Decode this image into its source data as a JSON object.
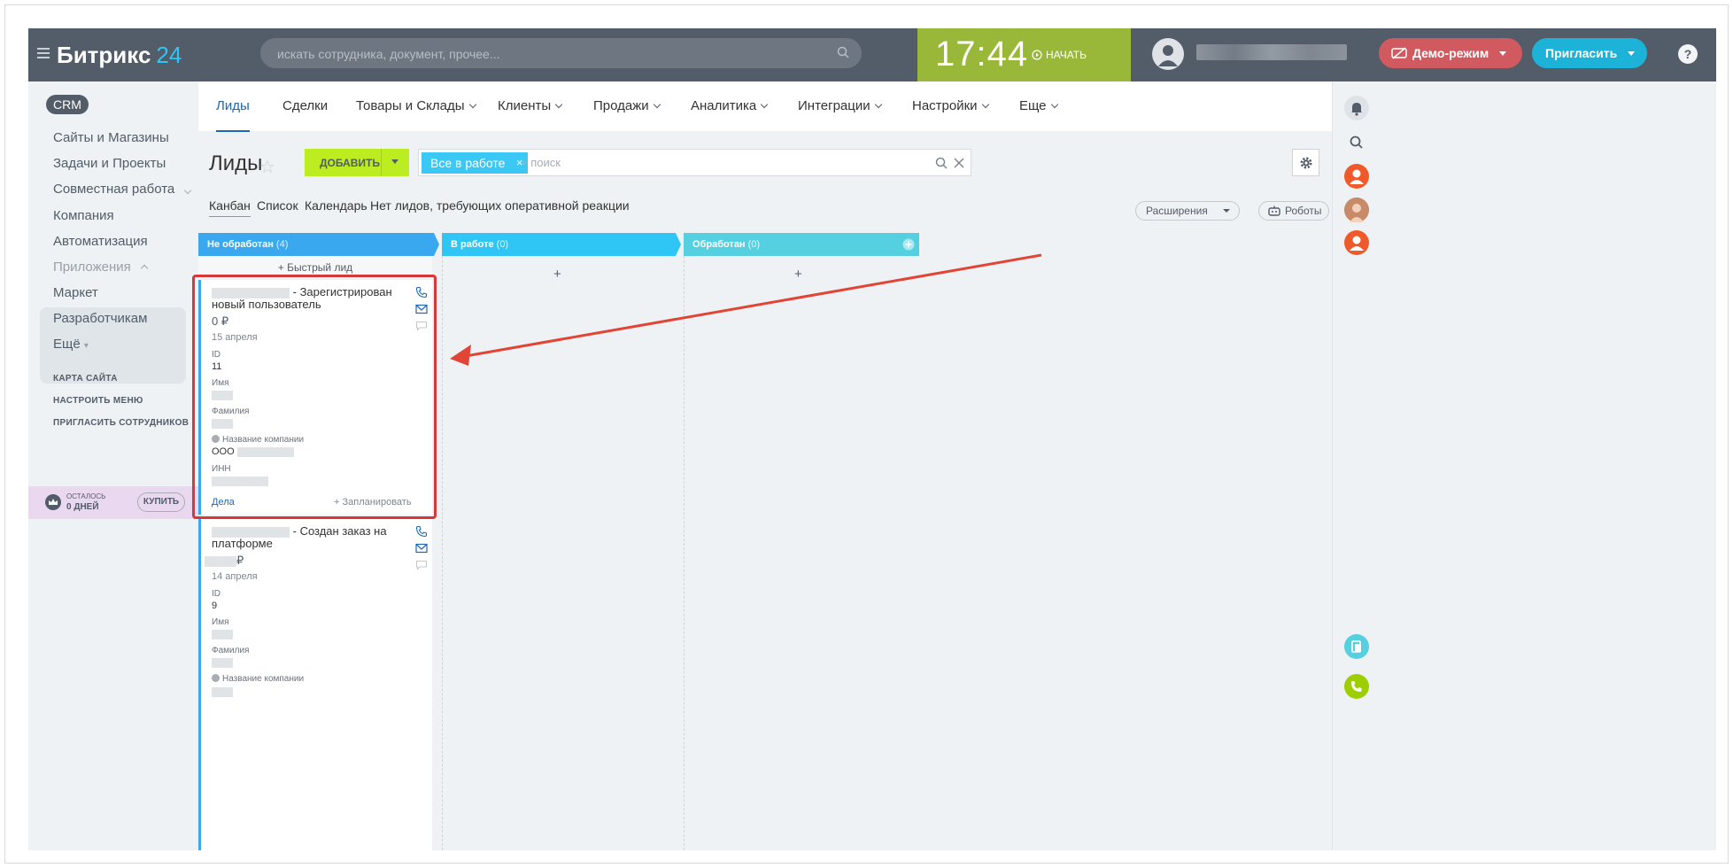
{
  "header": {
    "logo_name": "Битрикс",
    "logo_num": "24",
    "search_placeholder": "искать сотрудника, документ, прочее...",
    "clock": "17:44",
    "start_label": "НАЧАТЬ",
    "demo_label": "Демо-режим",
    "invite_label": "Пригласить",
    "help_label": "?"
  },
  "sidebar": {
    "crm": "CRM",
    "items": [
      "Сайты и Магазины",
      "Задачи и Проекты",
      "Совместная работа",
      "Компания",
      "Автоматизация"
    ],
    "apps": "Приложения",
    "apps_items": [
      "Маркет",
      "Разработчикам"
    ],
    "more": "Ещё",
    "links": [
      "КАРТА САЙТА",
      "НАСТРОИТЬ МЕНЮ",
      "ПРИГЛАСИТЬ СОТРУДНИКОВ"
    ],
    "trial_left": "ОСТАЛОСЬ",
    "trial_days": "0 ДНЕЙ",
    "buy": "КУПИТЬ"
  },
  "topnav": [
    "Лиды",
    "Сделки",
    "Товары и Склады",
    "Клиенты",
    "Продажи",
    "Аналитика",
    "Интеграции",
    "Настройки",
    "Еще"
  ],
  "page": {
    "title": "Лиды",
    "add_label": "ДОБАВИТЬ",
    "filter_chip": "Все в работе",
    "filter_placeholder": "+ поиск",
    "view_tabs": [
      "Канбан",
      "Список",
      "Календарь",
      "Нет лидов, требующих оперативной реакции"
    ],
    "extensions": "Расширения",
    "robots": "Роботы"
  },
  "kanban": {
    "stages": [
      {
        "name": "Не обработан",
        "count": "(4)",
        "color": "#39a8ef"
      },
      {
        "name": "В работе",
        "count": "(0)",
        "color": "#2fc6f6"
      },
      {
        "name": "Обработан",
        "count": "(0)",
        "color": "#55d0e0"
      }
    ],
    "quick_lead": "+ Быстрый лид",
    "add_symbol": "+",
    "cards": [
      {
        "title": "- Зарегистрирован новый пользователь",
        "money": "0 ₽",
        "date": "15 апреля",
        "id_label": "ID",
        "id_value": "11",
        "name_label": "Имя",
        "surname_label": "Фамилия",
        "company_label": "Название компании",
        "company_value": "ООО",
        "inn_label": "ИНН",
        "deals": "Дела",
        "plan": "+ Запланировать"
      },
      {
        "title": "- Создан заказ на платформе",
        "money": "₽",
        "date": "14 апреля",
        "id_label": "ID",
        "id_value": "9",
        "name_label": "Имя",
        "surname_label": "Фамилия",
        "company_label": "Название компании"
      }
    ]
  },
  "colors": {
    "header": "#535c69",
    "clock_bg": "#99b83a",
    "accent_green": "#bbed21",
    "accent_blue": "#2fc6f6",
    "highlight": "#d9383a"
  }
}
